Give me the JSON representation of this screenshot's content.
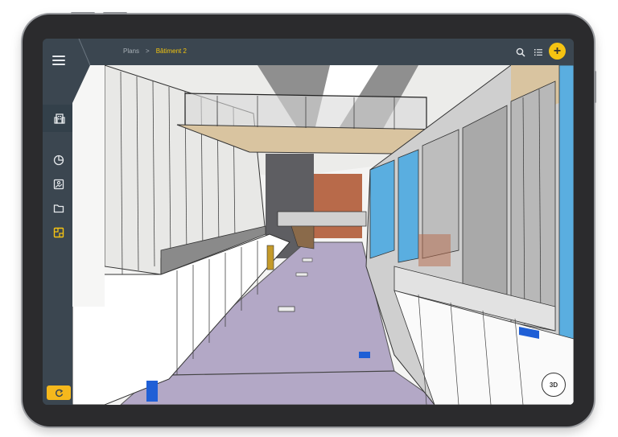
{
  "breadcrumb": {
    "root": "Plans",
    "separator": ">",
    "current": "Bâtiment 2"
  },
  "sidebar": {
    "items": [
      {
        "name": "building",
        "icon": "building-icon",
        "active": true
      },
      {
        "name": "stats",
        "icon": "pie-chart-icon"
      },
      {
        "name": "photo",
        "icon": "image-icon"
      },
      {
        "name": "folder",
        "icon": "folder-icon"
      },
      {
        "name": "plans",
        "icon": "floorplan-icon",
        "active_color": "#f5c312"
      }
    ]
  },
  "toolbar": {
    "add_label": "+",
    "view_3d_label": "3D"
  },
  "colors": {
    "chrome": "#3b4650",
    "accent": "#f5c312",
    "floor": "#b3a8c6",
    "glass_blue": "#5aaee0",
    "brick": "#b86a4a",
    "wood": "#d9c4a0"
  }
}
